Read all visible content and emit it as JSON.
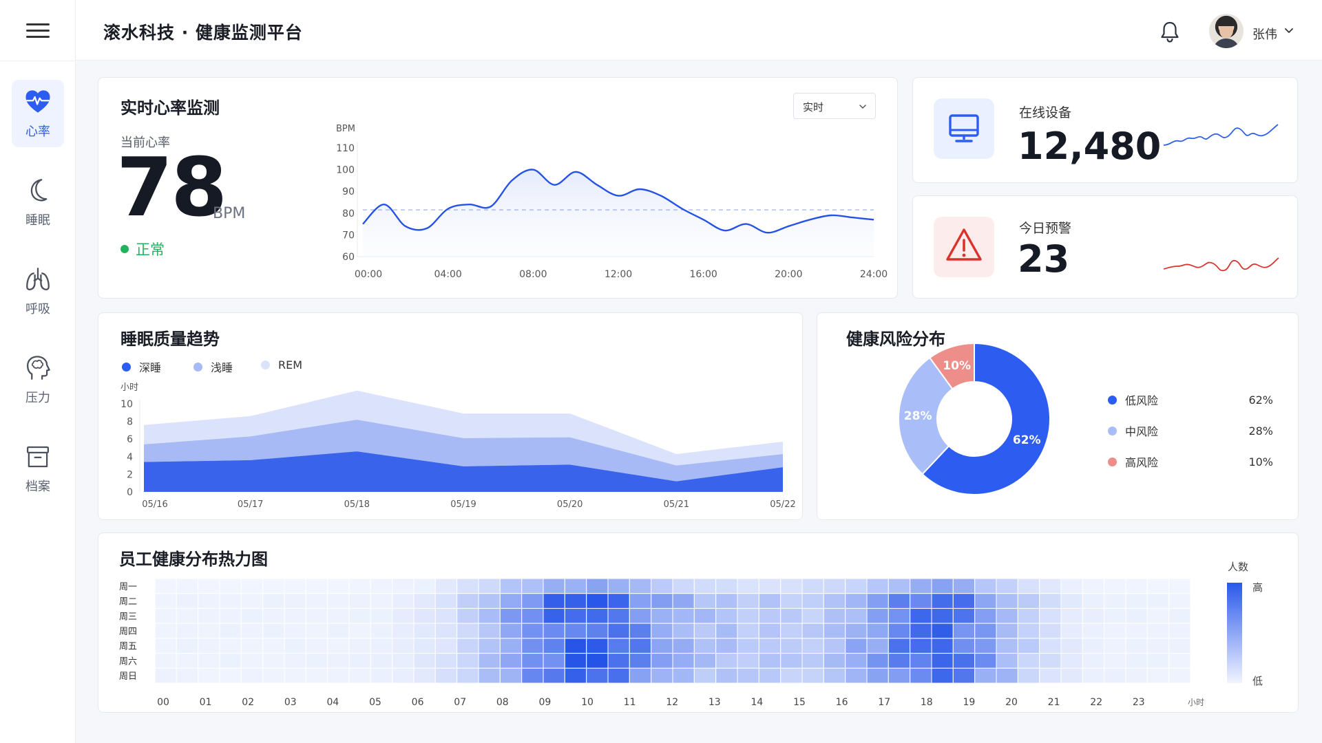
{
  "app": {
    "title": "滚水科技 · 健康监测平台"
  },
  "user": {
    "name": "张伟"
  },
  "sidebar": {
    "items": [
      {
        "label": "心率",
        "active": true,
        "icon": "heart-pulse-icon"
      },
      {
        "label": "睡眠",
        "active": false,
        "icon": "moon-icon"
      },
      {
        "label": "呼吸",
        "active": false,
        "icon": "lungs-icon"
      },
      {
        "label": "压力",
        "active": false,
        "icon": "head-brain-icon"
      },
      {
        "label": "档案",
        "active": false,
        "icon": "archive-box-icon"
      }
    ]
  },
  "heart_rate": {
    "title": "实时心率监测",
    "current_label": "当前心率",
    "value": "78",
    "unit": "BPM",
    "status": "正常",
    "range_select": "实时",
    "colors": {
      "line": "#2552e6",
      "status": "#21b35b"
    }
  },
  "stats": {
    "online": {
      "label": "在线设备",
      "value": "12,480",
      "spark_color": "#2f5fe8"
    },
    "alerts": {
      "label": "今日预警",
      "value": "23",
      "spark_color": "#d9342b"
    }
  },
  "sleep": {
    "title": "睡眠质量趋势",
    "unit_label": "小时"
  },
  "risk": {
    "title": "健康风险分布",
    "items": [
      {
        "label": "低风险",
        "value": "62%",
        "color": "#2c5cf0"
      },
      {
        "label": "中风险",
        "value": "28%",
        "color": "#a9bdf8"
      },
      {
        "label": "高风险",
        "value": "10%",
        "color": "#ee8e8a"
      }
    ]
  },
  "heatmap": {
    "title": "员工健康分布热力图",
    "legend_title": "人数",
    "legend_high": "高",
    "legend_low": "低",
    "x_unit": "小时"
  },
  "chart_data": [
    {
      "type": "line",
      "ylabel": "BPM",
      "ylim": [
        60,
        110
      ],
      "yticks": [
        60,
        70,
        80,
        90,
        100,
        110
      ],
      "x_ticks": [
        "00:00",
        "04:00",
        "08:00",
        "12:00",
        "16:00",
        "20:00",
        "24:00"
      ],
      "x": [
        0,
        1,
        2,
        3,
        4,
        5,
        6,
        7,
        8,
        9,
        10,
        11,
        12,
        13,
        14,
        15,
        16,
        17,
        18,
        19,
        20,
        21,
        22,
        23,
        24
      ],
      "values": [
        75,
        84,
        74,
        73,
        82,
        84,
        83,
        95,
        100,
        93,
        99,
        93,
        88,
        91,
        88,
        82,
        77,
        72,
        75,
        71,
        74,
        77,
        79,
        78,
        77
      ],
      "reference_line": 81.5
    },
    {
      "type": "area",
      "ylabel": "小时",
      "ylim": [
        0,
        10
      ],
      "yticks": [
        0,
        2,
        4,
        6,
        8,
        10
      ],
      "categories": [
        "05/16",
        "05/17",
        "05/18",
        "05/19",
        "05/20",
        "05/21",
        "05/22"
      ],
      "series": [
        {
          "name": "深睡",
          "color": "#3a63ec",
          "values": [
            3.4,
            3.6,
            4.6,
            2.9,
            3.1,
            1.2,
            2.8
          ]
        },
        {
          "name": "浅睡",
          "color": "#a7baf6",
          "values": [
            2.0,
            2.7,
            3.6,
            3.2,
            3.1,
            1.8,
            1.5
          ]
        },
        {
          "name": "REM",
          "color": "#dbe3fc",
          "values": [
            2.2,
            2.3,
            3.3,
            2.8,
            2.7,
            1.3,
            1.4
          ]
        }
      ]
    },
    {
      "type": "pie",
      "categories": [
        "低风险",
        "中风险",
        "高风险"
      ],
      "values": [
        62,
        28,
        10
      ],
      "labels": [
        "62%",
        "28%",
        "10%"
      ]
    },
    {
      "type": "heatmap",
      "y_categories": [
        "周一",
        "周二",
        "周三",
        "周四",
        "周五",
        "周六",
        "周日"
      ],
      "x_ticks": [
        "00",
        "01",
        "02",
        "03",
        "04",
        "05",
        "06",
        "07",
        "08",
        "09",
        "10",
        "11",
        "12",
        "13",
        "14",
        "15",
        "16",
        "17",
        "18",
        "19",
        "20",
        "21",
        "22",
        "23"
      ],
      "colorscale": [
        "#f5f8ff",
        "#2453e8"
      ]
    }
  ]
}
